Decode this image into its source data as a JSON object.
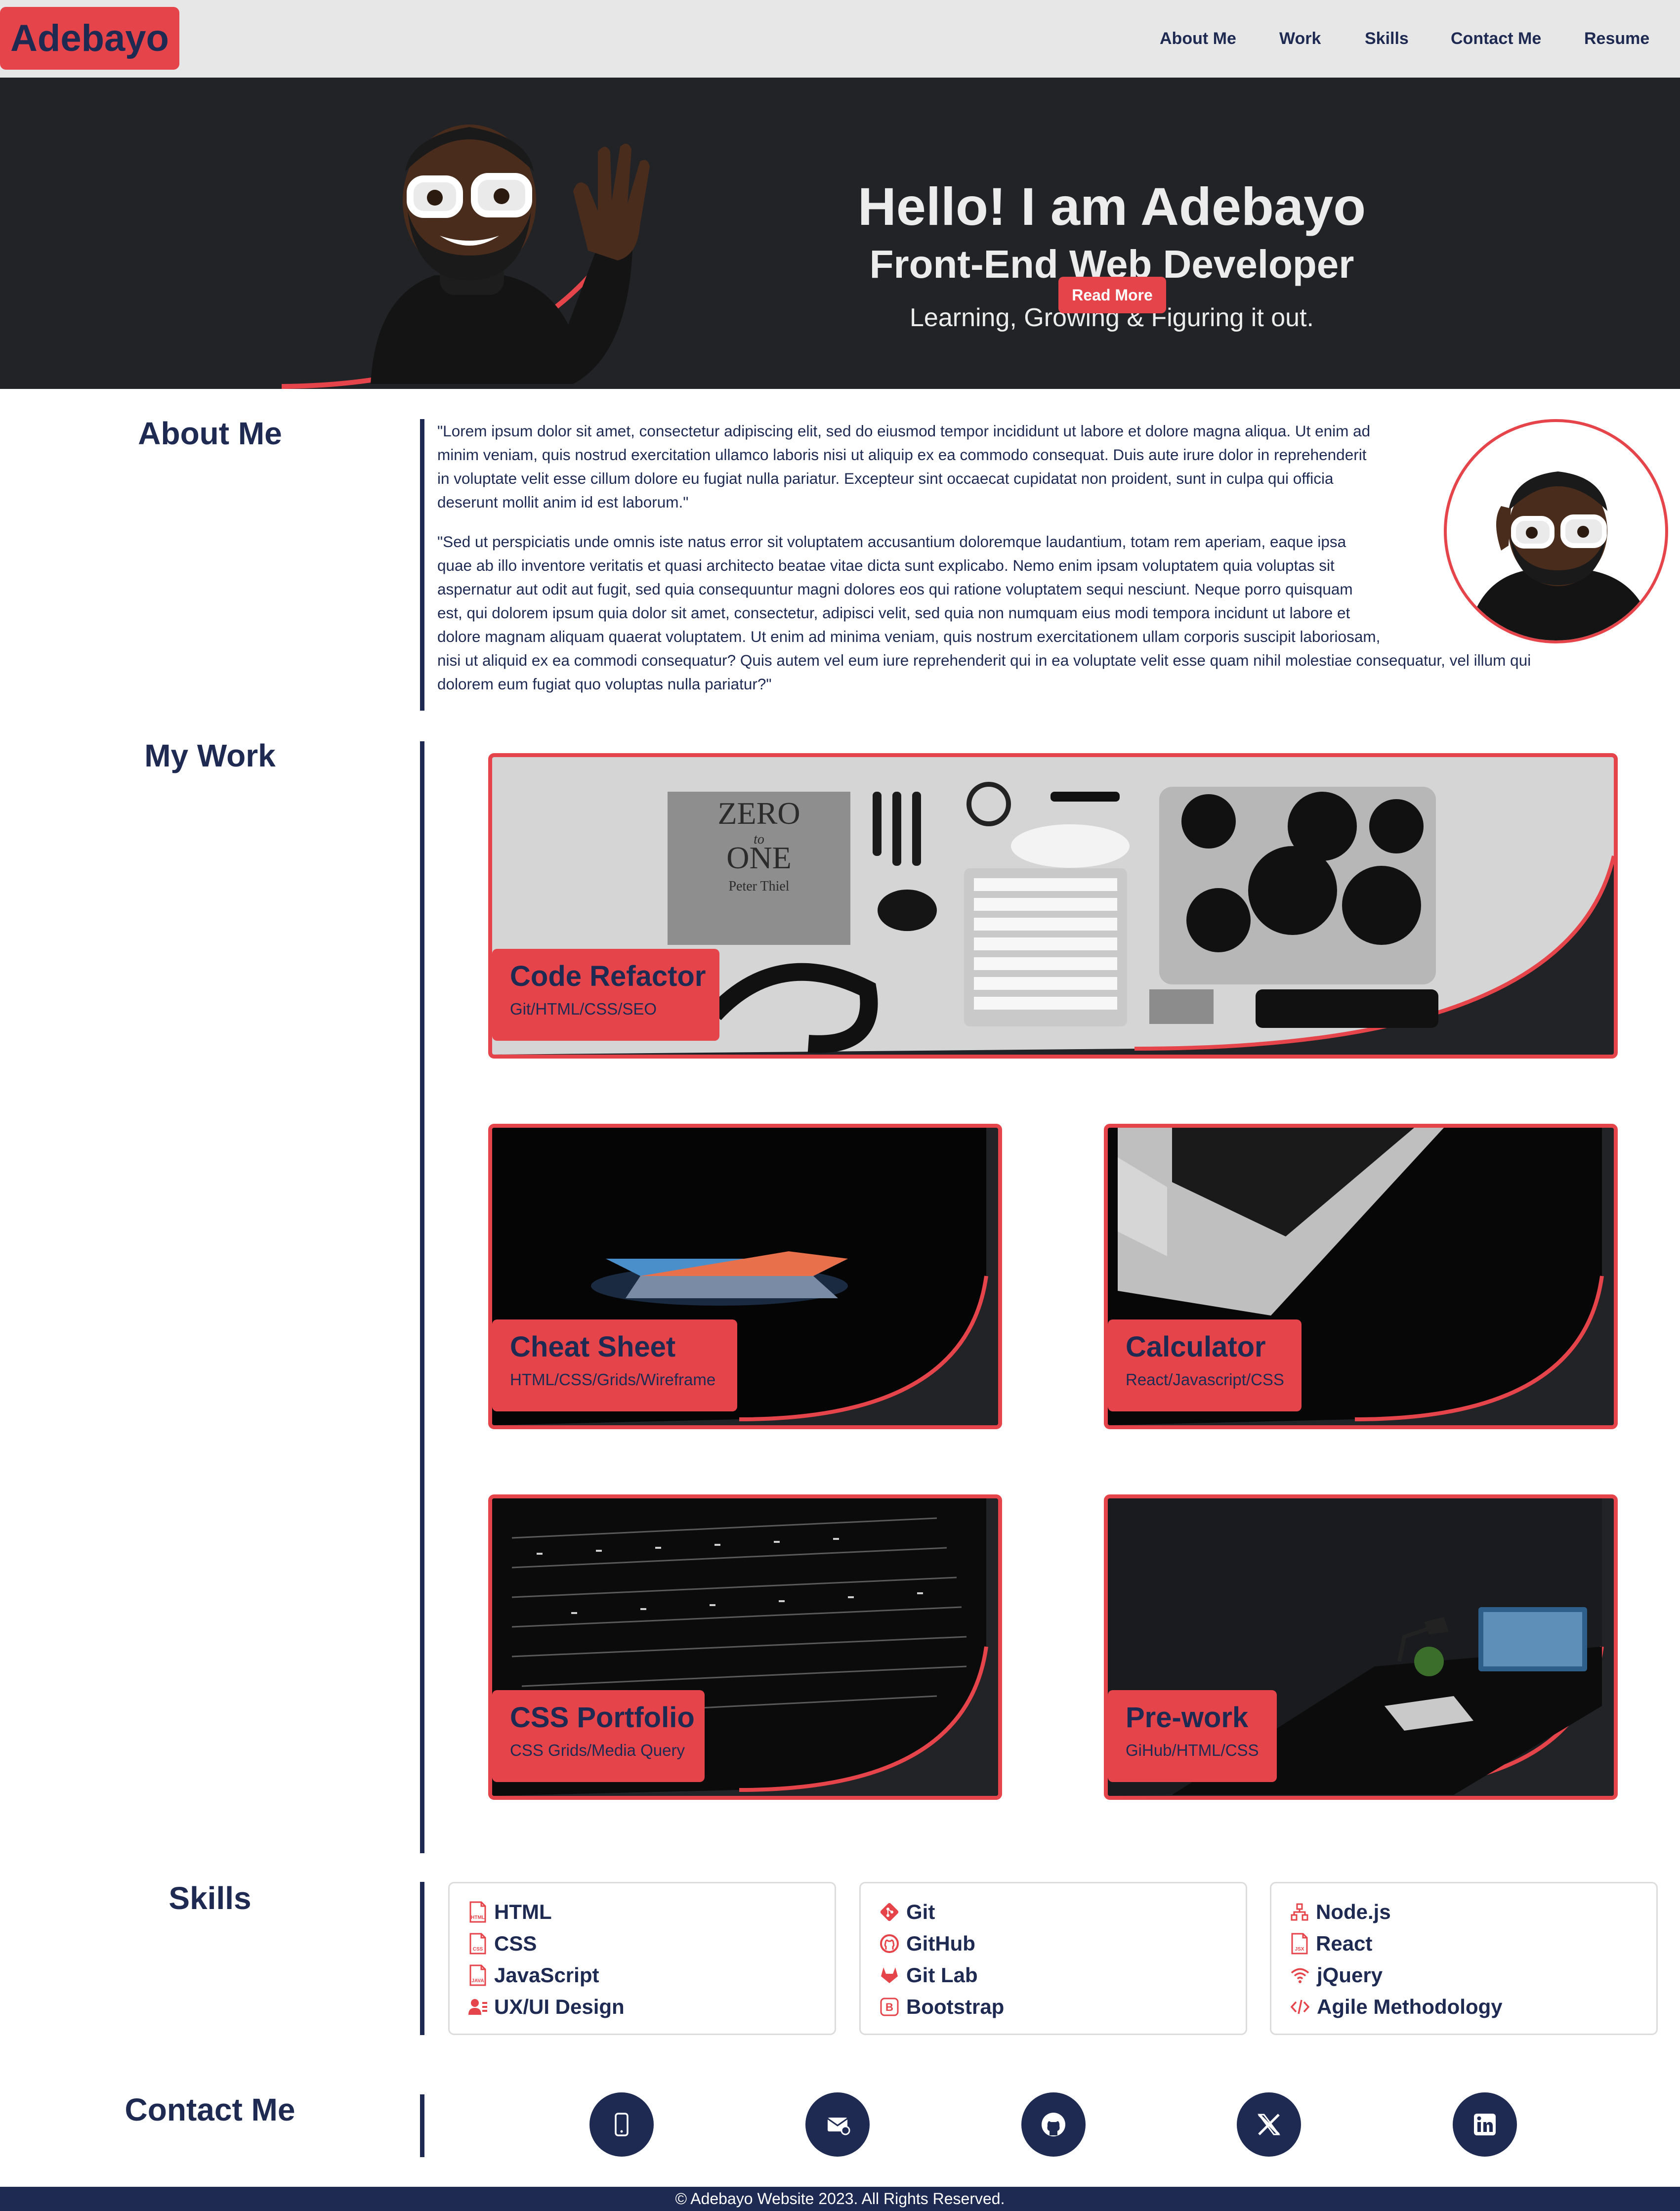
{
  "nav": {
    "logo": "Adebayo",
    "links": [
      "About Me",
      "Work",
      "Skills",
      "Contact Me",
      "Resume"
    ]
  },
  "hero": {
    "title": "Hello! I am Adebayo",
    "subtitle": "Front-End Web Developer",
    "tagline": "Learning, Growing & Figuring it out.",
    "button": "Read More"
  },
  "about": {
    "heading": "About Me",
    "p1_lines": [
      "\"Lorem ipsum dolor sit amet, consectetur adipiscing elit, sed do eiusmod tempor incididunt ut labore et dolore magna aliqua. Ut enim ad",
      "minim veniam, quis nostrud exercitation ullamco laboris nisi ut aliquip ex ea commodo consequat. Duis aute irure dolor in reprehenderit",
      "in voluptate velit esse cillum dolore eu fugiat nulla pariatur. Excepteur sint occaecat cupidatat non proident, sunt in culpa qui officia",
      "deserunt mollit anim id est laborum.\""
    ],
    "p2_lines": [
      "\"Sed ut perspiciatis unde omnis iste natus error sit voluptatem accusantium doloremque laudantium, totam rem aperiam, eaque ipsa",
      "quae ab illo inventore veritatis et quasi architecto beatae vitae dicta sunt explicabo. Nemo enim ipsam voluptatem quia voluptas sit",
      "aspernatur aut odit aut fugit, sed quia consequuntur magni dolores eos qui ratione voluptatem sequi nesciunt. Neque porro quisquam",
      "est, qui dolorem ipsum quia dolor sit amet, consectetur, adipisci velit, sed quia non numquam eius modi tempora incidunt ut labore et",
      "dolore magnam aliquam quaerat voluptatem. Ut enim ad minima veniam, quis nostrum exercitationem ullam corporis suscipit laboriosam,",
      "nisi ut aliquid ex ea commodi consequatur? Quis autem vel eum iure reprehenderit qui in ea voluptate velit esse quam nihil molestiae consequatur, vel illum qui",
      "dolorem eum fugiat quo voluptas nulla pariatur?\""
    ]
  },
  "work": {
    "heading": "My Work",
    "projects": [
      {
        "title": "Code Refactor",
        "tech": "Git/HTML/CSS/SEO"
      },
      {
        "title": "Cheat Sheet",
        "tech": "HTML/CSS/Grids/Wireframe"
      },
      {
        "title": "Calculator",
        "tech": "React/Javascript/CSS"
      },
      {
        "title": "CSS Portfolio",
        "tech": "CSS Grids/Media Query"
      },
      {
        "title": "Pre-work",
        "tech": "GiHub/HTML/CSS"
      }
    ],
    "book_title": "ZERO",
    "book_word": "to",
    "book_one": "ONE",
    "book_author": "Peter Thiel"
  },
  "skills": {
    "heading": "Skills",
    "columns": [
      [
        {
          "label": "HTML",
          "icon": "html-file-icon"
        },
        {
          "label": "CSS",
          "icon": "css-file-icon"
        },
        {
          "label": "JavaScript",
          "icon": "js-file-icon"
        },
        {
          "label": "UX/UI Design",
          "icon": "user-design-icon"
        }
      ],
      [
        {
          "label": "Git",
          "icon": "git-icon"
        },
        {
          "label": "GitHub",
          "icon": "github-icon"
        },
        {
          "label": "Git Lab",
          "icon": "gitlab-icon"
        },
        {
          "label": "Bootstrap",
          "icon": "bootstrap-icon"
        }
      ],
      [
        {
          "label": "Node.js",
          "icon": "node-icon"
        },
        {
          "label": "React",
          "icon": "jsx-file-icon"
        },
        {
          "label": "jQuery",
          "icon": "wifi-icon"
        },
        {
          "label": "Agile Methodology",
          "icon": "code-icon"
        }
      ]
    ]
  },
  "contact": {
    "heading": "Contact Me",
    "icons": [
      "phone-icon",
      "email-icon",
      "github-icon",
      "x-icon",
      "linkedin-icon"
    ]
  },
  "footer": {
    "text": "© Adebayo Website 2023. All Rights Reserved."
  },
  "colors": {
    "accent": "#e5444a",
    "navy": "#1e2a52",
    "nav_bg": "#e7e7e7",
    "hero_bg": "#212327"
  }
}
